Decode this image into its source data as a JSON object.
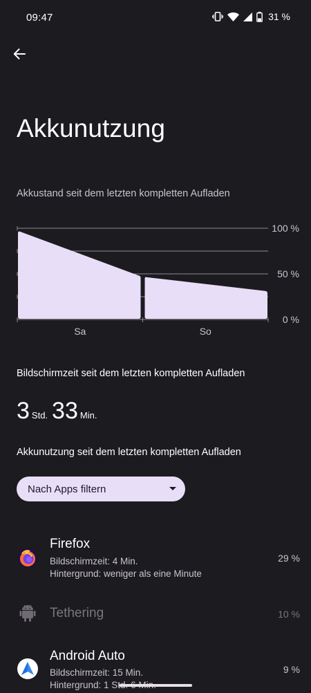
{
  "status": {
    "time": "09:47",
    "battery_percent": "31 %"
  },
  "header": {
    "title": "Akkunutzung"
  },
  "chart_section": {
    "caption": "Akkustand seit dem letzten kompletten Aufladen"
  },
  "chart_data": {
    "type": "area",
    "title": "",
    "xlabel": "",
    "ylabel": "",
    "ylim": [
      0,
      100
    ],
    "y_tick_labels": [
      "100 %",
      "50 %",
      "0 %"
    ],
    "categories": [
      "Sa",
      "So"
    ],
    "segments": [
      {
        "label": "Sa",
        "start": 97,
        "end": 48
      },
      {
        "label": "So",
        "start": 47,
        "end": 31
      }
    ],
    "colors": {
      "fill": "#e8def8",
      "grid": "#8f8a94"
    },
    "grid": true
  },
  "screen_time": {
    "label": "Bildschirmzeit seit dem letzten kompletten Aufladen",
    "hours": "3",
    "hours_unit": "Std.",
    "minutes": "33",
    "minutes_unit": "Min."
  },
  "usage": {
    "label": "Akkunutzung seit dem letzten kompletten Aufladen",
    "filter_label": "Nach Apps filtern"
  },
  "apps": [
    {
      "name": "Firefox",
      "icon": "firefox-icon",
      "line1": "Bildschirmzeit: 4 Min.",
      "line2": "Hintergrund: weniger als eine Minute",
      "percent": "29 %"
    },
    {
      "name": "Tethering",
      "icon": "android-icon",
      "percent": "10 %"
    },
    {
      "name": "Android Auto",
      "icon": "android-auto-icon",
      "line1": "Bildschirmzeit: 15 Min.",
      "line2": "Hintergrund: 1 Std. 6 Min.",
      "percent": "9 %"
    }
  ],
  "colors": {
    "background": "#1c1b1f",
    "accent": "#e8def8"
  }
}
